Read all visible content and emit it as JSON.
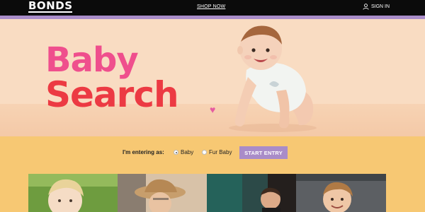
{
  "header": {
    "logo": "BONDS",
    "shop_now": "SHOP NOW",
    "sign_in": "SIGN IN",
    "user_icon": "user-icon"
  },
  "hero": {
    "title_line1": "Baby",
    "title_line2": "Search",
    "heart_icon": "heart-icon",
    "colors": {
      "baby": "#ef4f8d",
      "search": "#ec3a43",
      "background": "#f9dcc2"
    }
  },
  "entry": {
    "label": "I'm entering as:",
    "options": [
      {
        "label": "Baby",
        "selected": true
      },
      {
        "label": "Fur Baby",
        "selected": false
      }
    ],
    "button": "START ENTRY",
    "colors": {
      "bar": "#f7c873",
      "button": "#a98cc8"
    }
  }
}
